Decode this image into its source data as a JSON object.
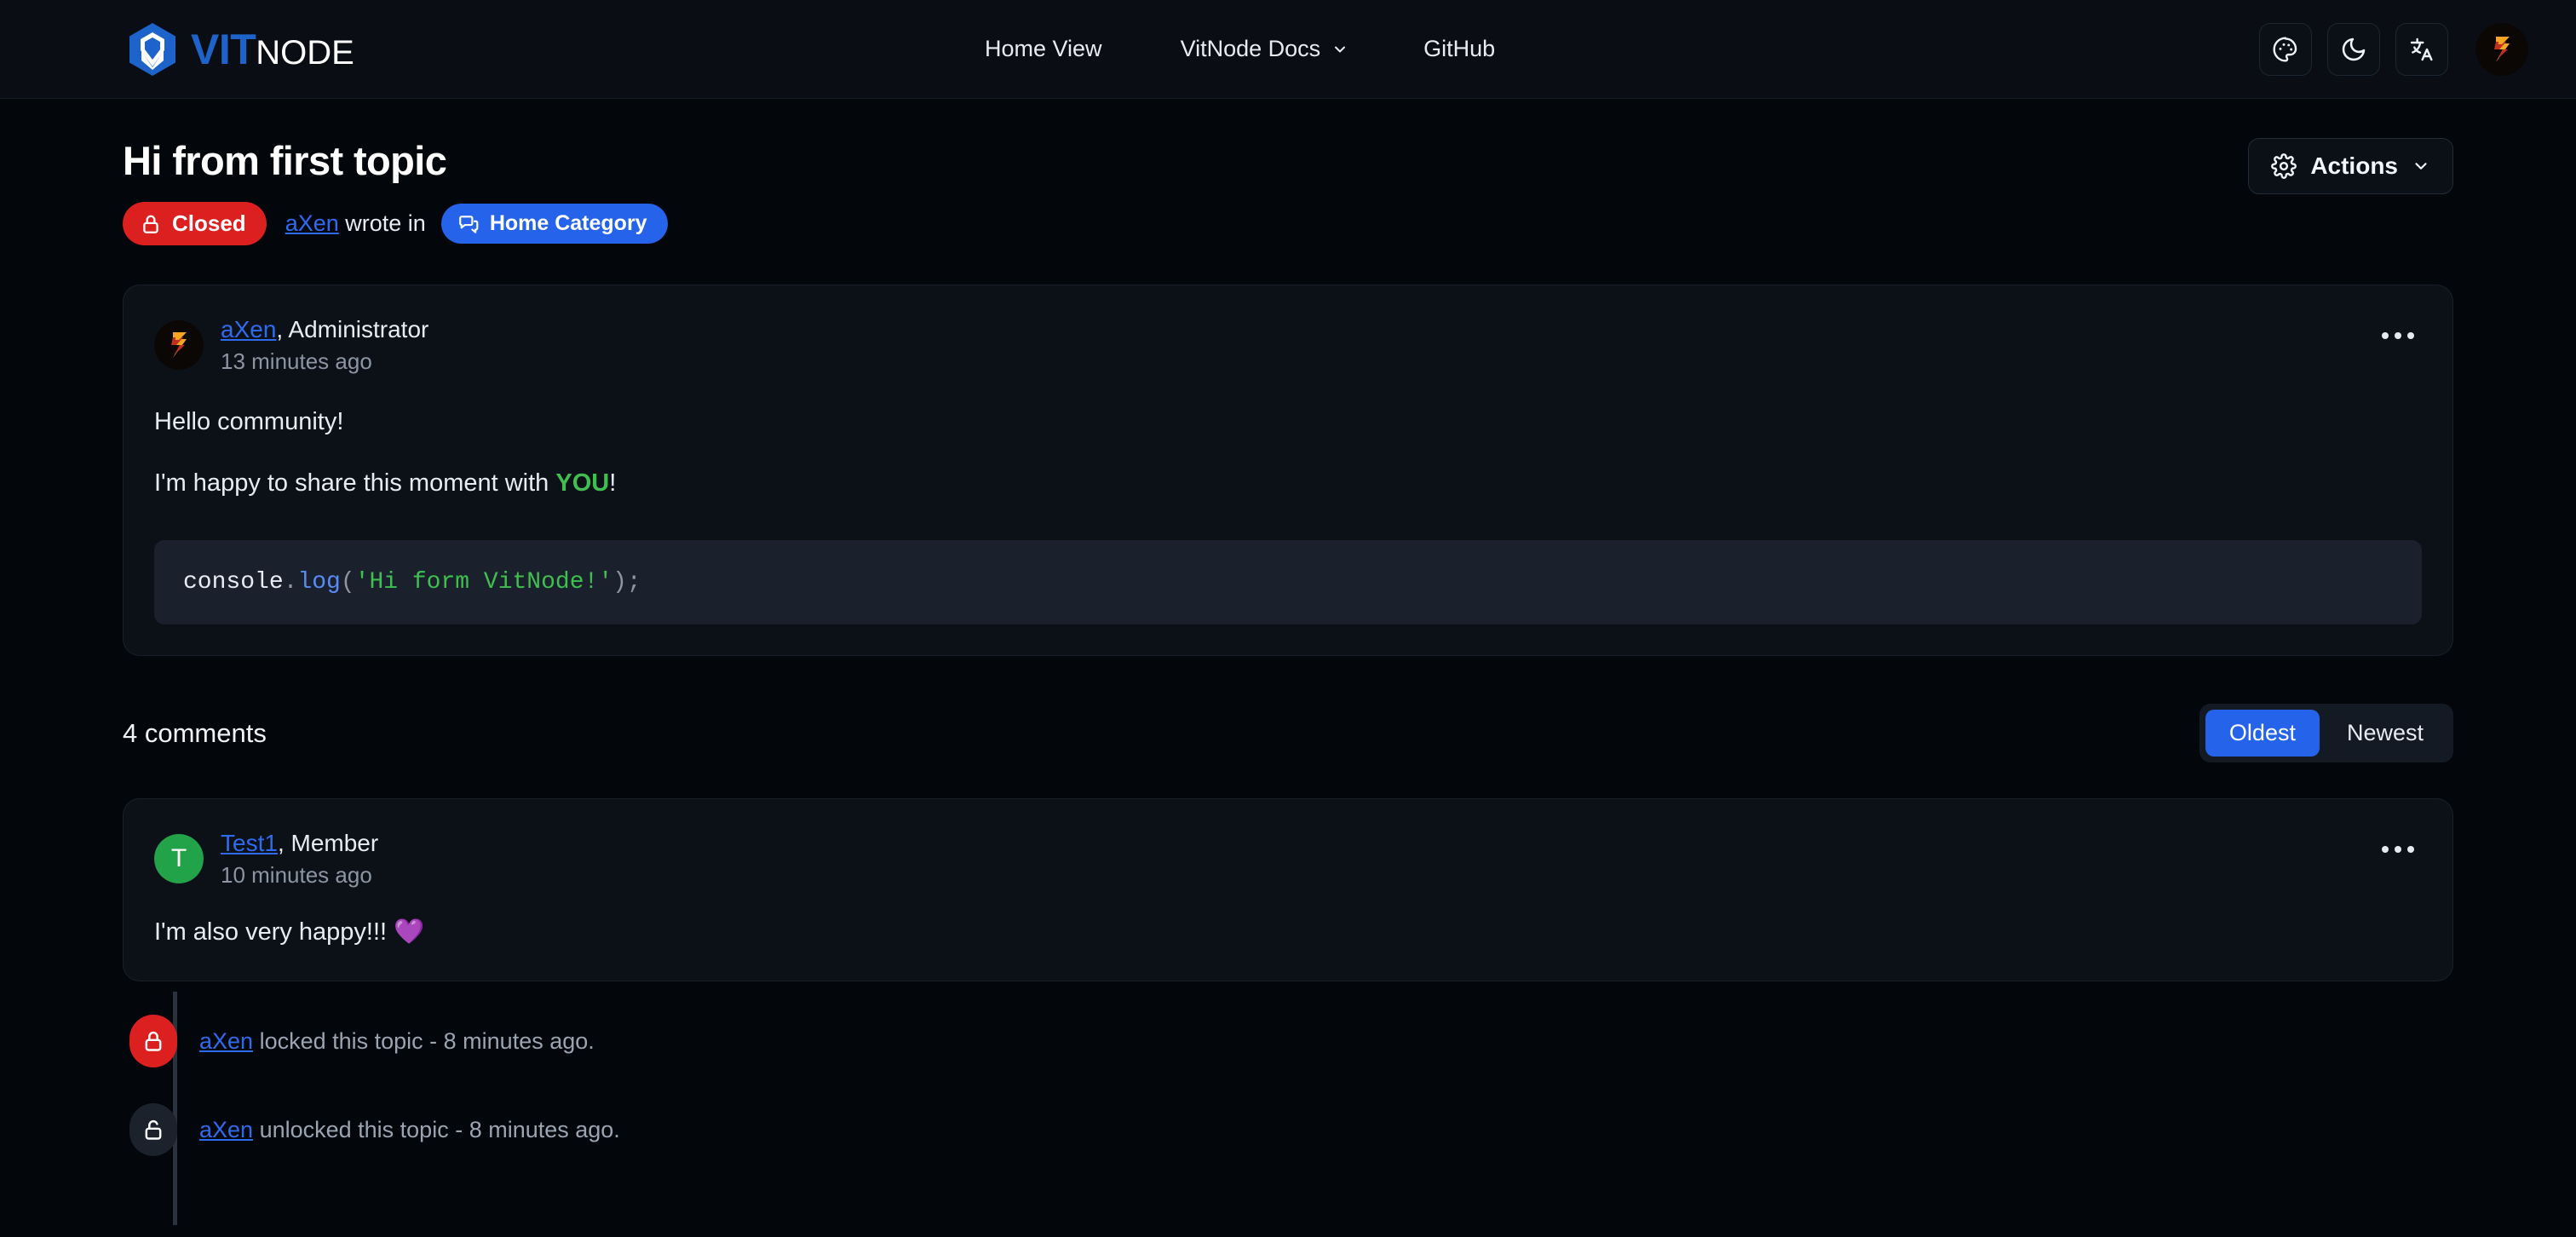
{
  "header": {
    "brand": {
      "primary": "VIT",
      "secondary": "NODE"
    },
    "nav": [
      {
        "label": "Home View",
        "has_chevron": false,
        "icon": ""
      },
      {
        "label": "VitNode Docs",
        "has_chevron": true,
        "icon": "chevron-down-icon"
      },
      {
        "label": "GitHub",
        "has_chevron": false,
        "icon": ""
      }
    ],
    "actions": [
      {
        "name": "theme-palette-icon",
        "label": "Color theme"
      },
      {
        "name": "moon-icon",
        "label": "Dark mode"
      },
      {
        "name": "translate-icon",
        "label": "Language"
      }
    ],
    "avatar": {
      "name": "user-avatar",
      "alt": "aXen"
    }
  },
  "topic": {
    "title": "Hi from first topic",
    "status_badge": {
      "label": "Closed",
      "icon": "lock-icon",
      "color": "#dc2020"
    },
    "author": "aXen",
    "wrote_in_text": "wrote in",
    "category": {
      "label": "Home Category",
      "icon": "category-icon",
      "color": "#2563eb"
    },
    "actions_button": {
      "label": "Actions",
      "icon": "gear-icon",
      "chevron": "chevron-down-icon"
    }
  },
  "post": {
    "author": "aXen",
    "role": "Administrator",
    "timestamp": "13 minutes ago",
    "paragraphs": [
      {
        "text": "Hello community!"
      }
    ],
    "paragraph2": {
      "before": "I'm happy to share this moment with ",
      "highlight": "YOU",
      "after": "!"
    },
    "code": {
      "object": "console",
      "dot": ".",
      "method": "log",
      "open": "(",
      "string": "'Hi form VitNode!'",
      "close": ");"
    }
  },
  "comments_section": {
    "count_label": "4 comments",
    "sort": {
      "oldest": "Oldest",
      "newest": "Newest",
      "active": "Oldest"
    }
  },
  "comments": [
    {
      "author": "Test1",
      "role": "Member",
      "timestamp": "10 minutes ago",
      "avatar_letter": "T",
      "avatar_color": "#22a34a",
      "body": "I'm also very happy!!! 💜"
    }
  ],
  "activity": [
    {
      "icon": "lock-icon",
      "state": "locked",
      "actor": "aXen",
      "text": " locked this topic - 8 minutes ago."
    },
    {
      "icon": "unlock-icon",
      "state": "unlocked",
      "actor": "aXen",
      "text": " unlocked this topic - 8 minutes ago."
    }
  ],
  "colors": {
    "page_bg": "#03060a",
    "header_bg": "#0a0e14",
    "card_bg": "#0c1118",
    "card_border": "#1a2029",
    "accent_blue": "#2563eb",
    "link_blue": "#2f6bf0",
    "danger_red": "#dc2020",
    "success_green": "#3fbf4f",
    "code_bg": "#1b212c",
    "muted_text": "#8b95a3"
  }
}
